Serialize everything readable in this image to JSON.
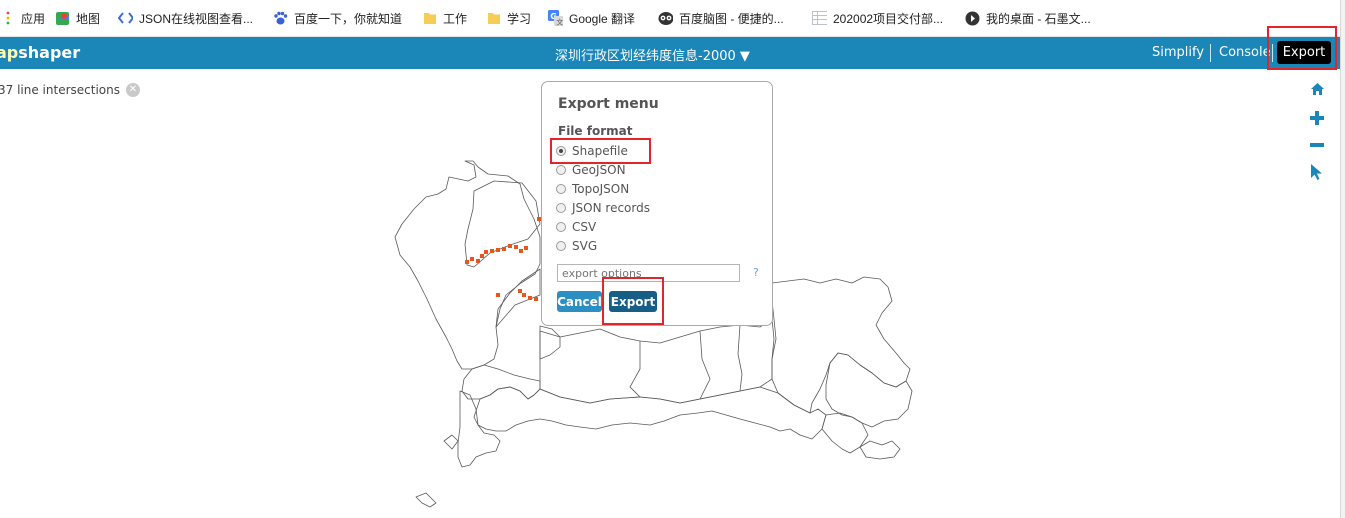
{
  "bookmarks": [
    {
      "label": "应用",
      "icon": "apps-grid-icon"
    },
    {
      "label": "地图",
      "icon": "maps-pin-icon"
    },
    {
      "label": "JSON在线视图查看...",
      "icon": "code-brackets-icon"
    },
    {
      "label": "百度一下，你就知道",
      "icon": "baidu-paw-icon"
    },
    {
      "label": "工作",
      "icon": "folder-icon"
    },
    {
      "label": "学习",
      "icon": "folder-icon"
    },
    {
      "label": "Google 翻译",
      "icon": "google-translate-icon"
    },
    {
      "label": "百度脑图 - 便捷的...",
      "icon": "owl-icon"
    },
    {
      "label": "202002项目交付部...",
      "icon": "spreadsheet-icon"
    },
    {
      "label": "我的桌面 - 石墨文...",
      "icon": "shimo-icon"
    }
  ],
  "header": {
    "logo_prefix": "ap",
    "logo_suffix": "shaper",
    "layer_title": "深圳行政区划经纬度信息-2000 ▼",
    "simplify": "Simplify",
    "console": "Console",
    "export": "Export"
  },
  "intersections": {
    "text": "37 line intersections"
  },
  "export_menu": {
    "title": "Export menu",
    "file_format_label": "File format",
    "options": [
      "Shapefile",
      "GeoJSON",
      "TopoJSON",
      "JSON records",
      "CSV",
      "SVG"
    ],
    "selected": "Shapefile",
    "options_placeholder": "export options",
    "help": "?",
    "cancel": "Cancel",
    "export": "Export"
  },
  "colors": {
    "header_bg": "#1a87b8",
    "intersection_marker": "#e8561b",
    "annotation_red": "#e0262a",
    "tool_blue": "#1a87b8"
  },
  "tools": [
    "home-icon",
    "zoom-in-icon",
    "zoom-out-icon",
    "pointer-icon"
  ]
}
